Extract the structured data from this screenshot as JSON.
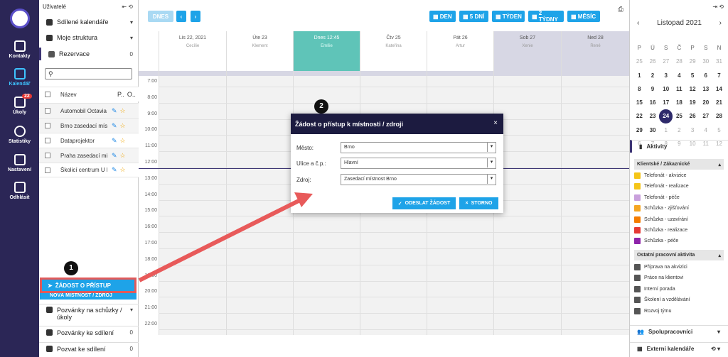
{
  "nav": {
    "items": [
      {
        "label": "Kontakty"
      },
      {
        "label": "Kalendář"
      },
      {
        "label": "Úkoly",
        "badge": "22"
      },
      {
        "label": "Statistiky"
      },
      {
        "label": "Nastavení"
      },
      {
        "label": "Odhlásit"
      }
    ]
  },
  "left": {
    "header": "Uživatelé",
    "sections": [
      {
        "label": "Sdílené kalendáře"
      },
      {
        "label": "Moje struktura"
      },
      {
        "label": "Rezervace",
        "count": "0"
      }
    ],
    "table_headers": {
      "name": "Název",
      "p": "P..",
      "o": "O.."
    },
    "rows": [
      "Automobil Octavia",
      "Brno zasedací míst...",
      "Dataprojektor",
      "Praha zasedací mí...",
      "Školicí centrum U li..."
    ],
    "request_btn": "ŽÁDOST O PŘÍSTUP",
    "new_btn": "NOVÁ MÍSTNOST / ZDROJ",
    "bottom": [
      {
        "label": "Pozvánky na schůzky / úkoly",
        "count": ""
      },
      {
        "label": "Pozvánky ke sdílení",
        "count": "0"
      },
      {
        "label": "Pozvat ke sdílení",
        "count": "0"
      }
    ]
  },
  "toolbar": {
    "today": "DNES",
    "views": [
      "DEN",
      "5 DNÍ",
      "TÝDEN",
      "2 TÝDNY",
      "MĚSÍC"
    ]
  },
  "days": [
    {
      "d": "Lis 22, 2021",
      "n": "Cecílie"
    },
    {
      "d": "Úte 23",
      "n": "Klement"
    },
    {
      "d": "Dnes 12:45",
      "n": "Emílie"
    },
    {
      "d": "Čtv 25",
      "n": "Kateřina"
    },
    {
      "d": "Pát 26",
      "n": "Artur"
    },
    {
      "d": "Sob 27",
      "n": "Xenie"
    },
    {
      "d": "Ned 28",
      "n": "René"
    }
  ],
  "times": [
    "7:00",
    "8:00",
    "9:00",
    "10:00",
    "11:00",
    "12:00",
    "13:00",
    "14:00",
    "15:00",
    "16:00",
    "17:00",
    "18:00",
    "19:00",
    "20:00",
    "21:00",
    "22:00"
  ],
  "dialog": {
    "title": "Žádost o přístup k místnosti / zdroji",
    "fields": [
      {
        "label": "Město:",
        "value": "Brno"
      },
      {
        "label": "Ulice a č.p.:",
        "value": "Hlavní"
      },
      {
        "label": "Zdroj:",
        "value": "Zasedací místnost Brno"
      }
    ],
    "send": "ODESLAT ŽÁDOST",
    "cancel": "STORNO"
  },
  "annotations": {
    "one": "1",
    "two": "2"
  },
  "right": {
    "month": "Listopad 2021",
    "weekdays": [
      "P",
      "Ú",
      "S",
      "Č",
      "P",
      "S",
      "N"
    ],
    "weeks": [
      [
        "25",
        "26",
        "27",
        "28",
        "29",
        "30",
        "31"
      ],
      [
        "1",
        "2",
        "3",
        "4",
        "5",
        "6",
        "7"
      ],
      [
        "8",
        "9",
        "10",
        "11",
        "12",
        "13",
        "14"
      ],
      [
        "15",
        "16",
        "17",
        "18",
        "19",
        "20",
        "21"
      ],
      [
        "22",
        "23",
        "24",
        "25",
        "26",
        "27",
        "28"
      ],
      [
        "29",
        "30",
        "1",
        "2",
        "3",
        "4",
        "5"
      ],
      [
        "6",
        "7",
        "8",
        "9",
        "10",
        "11",
        "12"
      ]
    ],
    "activities": "Aktivity",
    "group1": "Klientské / Zákaznické",
    "items1": [
      {
        "label": "Telefonát - akvizice",
        "color": "#f5c518"
      },
      {
        "label": "Telefonát - realizace",
        "color": "#f5c518"
      },
      {
        "label": "Telefonát - péče",
        "color": "#c9a0dc"
      },
      {
        "label": "Schůzka - zjišťování",
        "color": "#f5a623"
      },
      {
        "label": "Schůzka - uzavírání",
        "color": "#f57c00"
      },
      {
        "label": "Schůzka - realizace",
        "color": "#e53935"
      },
      {
        "label": "Schůzka - péče",
        "color": "#8e24aa"
      }
    ],
    "group2": "Ostatní pracovní aktivita",
    "items2": [
      {
        "label": "Příprava na akvizici",
        "color": "#555"
      },
      {
        "label": "Práce na klientovi",
        "color": "#555"
      },
      {
        "label": "Interní porada",
        "color": "#555"
      },
      {
        "label": "Školení a vzdělávání",
        "color": "#555"
      },
      {
        "label": "Rozvoj týmu",
        "color": "#555"
      }
    ],
    "coworkers": "Spolupracovníci",
    "external": "Externí kalendáře"
  }
}
